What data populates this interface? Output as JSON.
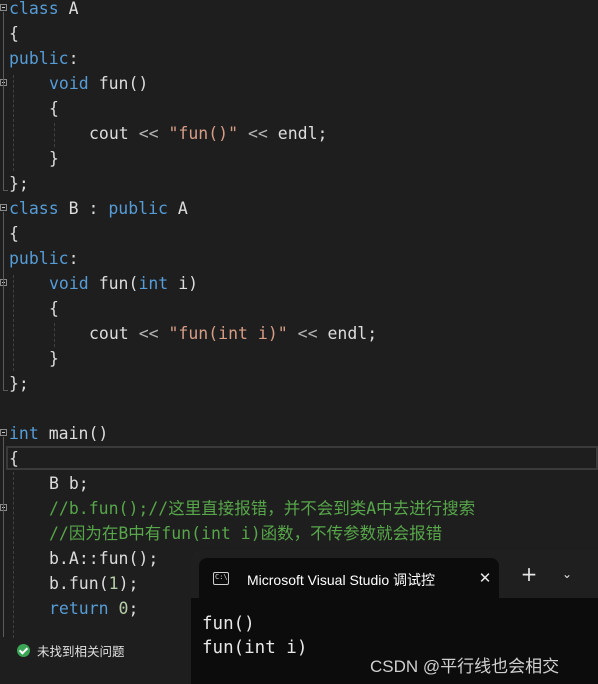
{
  "editor": {
    "lines": [
      [
        "class A"
      ],
      [
        "{"
      ],
      [
        "public:"
      ],
      [
        "void fun()"
      ],
      [
        "{"
      ],
      [
        "cout << \"fun()\" << endl;"
      ],
      [
        "}"
      ],
      [
        "};"
      ],
      [
        "class B : public A"
      ],
      [
        "{"
      ],
      [
        "public:"
      ],
      [
        "void fun(int i)"
      ],
      [
        "{"
      ],
      [
        "cout << \"fun(int i)\" << endl;"
      ],
      [
        "}"
      ],
      [
        "};"
      ],
      [
        ""
      ],
      [
        "int main()"
      ],
      [
        "{"
      ],
      [
        "B b;"
      ],
      [
        "//b.fun();//这里直接报错，并不会到类A中去进行搜索"
      ],
      [
        "//因为在B中有fun(int i)函数，不传参数就会报错"
      ],
      [
        "b.A::fun();"
      ],
      [
        "b.fun(1);"
      ],
      [
        "return 0;"
      ]
    ],
    "tokens": {
      "l0": [
        "class",
        "A"
      ],
      "l1": [
        "{"
      ],
      "l2": [
        "public",
        ":"
      ],
      "l3": [
        "void",
        "fun",
        "()"
      ],
      "l4": [
        "{"
      ],
      "l5": [
        "cout",
        "<<",
        "\"fun()\"",
        "<<",
        "endl",
        ";"
      ],
      "l6": [
        "}"
      ],
      "l7": [
        "};"
      ],
      "l8": [
        "class",
        "B",
        ":",
        "public",
        "A"
      ],
      "l9": [
        "{"
      ],
      "l10": [
        "public",
        ":"
      ],
      "l11": [
        "void",
        "fun",
        "(",
        "int",
        "i",
        ")"
      ],
      "l12": [
        "{"
      ],
      "l13": [
        "cout",
        "<<",
        "\"fun(int i)\"",
        "<<",
        "endl",
        ";"
      ],
      "l14": [
        "}"
      ],
      "l15": [
        "};"
      ],
      "l17": [
        "int",
        "main",
        "()"
      ],
      "l18": [
        "{"
      ],
      "l19": [
        "B",
        "b;"
      ],
      "l20": [
        "//b.fun();//这里直接报错，并不会到类A中去进行搜索"
      ],
      "l21": [
        "//因为在B中有fun(int i)函数，不传参数就会报错"
      ],
      "l22": [
        "b.",
        "A",
        "::",
        "fun",
        "();"
      ],
      "l23": [
        "b.",
        "fun",
        "(",
        "1",
        ");"
      ],
      "l24": [
        "return",
        "0",
        ";"
      ]
    }
  },
  "status": {
    "message": "未找到相关问题"
  },
  "console": {
    "tab_title": "Microsoft Visual Studio 调试控",
    "tab_icon_text": "C:\\",
    "close_glyph": "✕",
    "new_tab_glyph": "+",
    "dropdown_glyph": "⌄",
    "output": [
      "fun()",
      "fun(int i)"
    ]
  },
  "watermark": "CSDN @平行线也会相交",
  "colors": {
    "background": "#1e1e1e",
    "keyword": "#569cd6",
    "string": "#d69d85",
    "comment": "#57a64a",
    "number": "#b5cea8",
    "text": "#dcdcdc",
    "console_bg": "#0c0c0c",
    "status_ok": "#3aa655"
  }
}
